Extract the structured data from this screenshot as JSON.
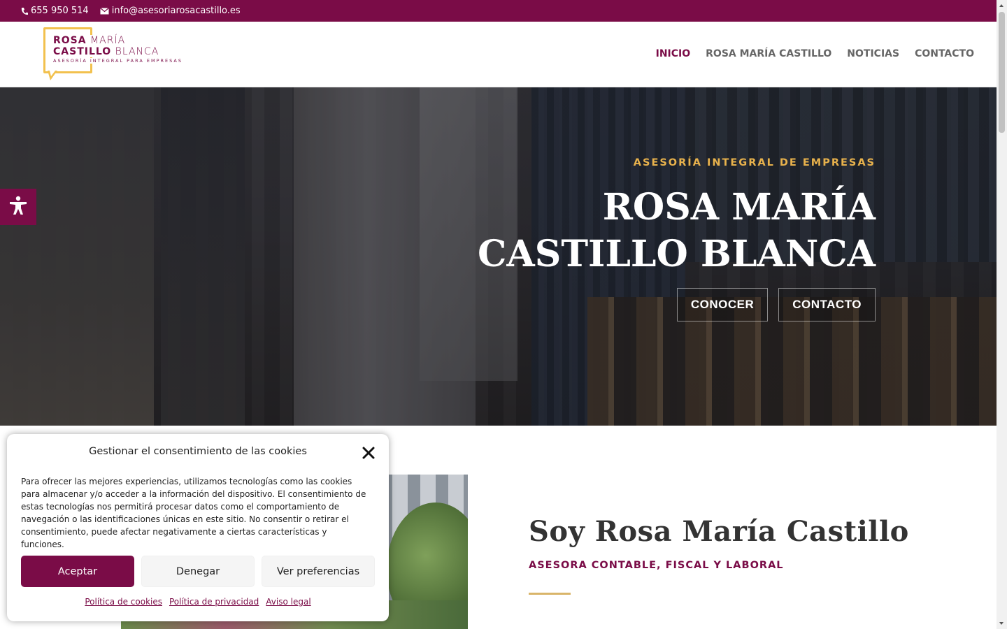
{
  "topbar": {
    "phone": "655 950 514",
    "email": "info@asesoriarosacastillo.es",
    "background": "#7a0c47"
  },
  "logo": {
    "line1_bold": "ROSA",
    "line1_light": "MARÍA",
    "line2_bold": "CASTILLO",
    "line2_light": "BLANCA",
    "tagline": "ASESORÍA INTEGRAL PARA EMPRESAS"
  },
  "nav": {
    "items": [
      {
        "label": "INICIO"
      },
      {
        "label": "ROSA MARÍA CASTILLO"
      },
      {
        "label": "NOTICIAS"
      },
      {
        "label": "CONTACTO"
      }
    ],
    "active_color": "#7a0c47"
  },
  "hero": {
    "subtitle": "ASESORÍA INTEGRAL DE EMPRESAS",
    "title_line1": "ROSA MARÍA",
    "title_line2": "CASTILLO BLANCA",
    "button_conocer": "CONOCER",
    "button_contacto": "CONTACTO",
    "subtitle_color": "#e8b24c"
  },
  "about": {
    "heading": "Soy Rosa María Castillo",
    "role": "ASESORA CONTABLE, FISCAL Y LABORAL",
    "rule_color": "#d9b56a"
  },
  "cookie": {
    "title": "Gestionar el consentimiento de las cookies",
    "text": "Para ofrecer las mejores experiencias, utilizamos tecnologías como las cookies para almacenar y/o acceder a la información del dispositivo. El consentimiento de estas tecnologías nos permitirá procesar datos como el comportamiento de navegación o las identificaciones únicas en este sitio. No consentir o retirar el consentimiento, puede afectar negativamente a ciertas características y funciones.",
    "accept": "Aceptar",
    "deny": "Denegar",
    "preferences": "Ver preferencias",
    "links": [
      "Política de cookies",
      "Política de privacidad",
      "Aviso legal"
    ]
  },
  "icons": {
    "phone": "phone-icon",
    "email": "envelope-icon",
    "accessibility": "accessibility-icon",
    "close": "close-icon"
  }
}
